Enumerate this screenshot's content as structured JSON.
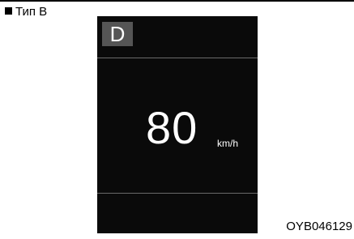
{
  "header": {
    "type_label": "Тип B"
  },
  "display": {
    "gear": "D",
    "speed": "80",
    "unit": "km/h"
  },
  "footer": {
    "figure_code": "OYB046129"
  },
  "colors": {
    "display_background": "#0a0a0a",
    "gear_box": "#555555",
    "divider": "#6a6a6a",
    "text_on_display": "#ffffff"
  }
}
